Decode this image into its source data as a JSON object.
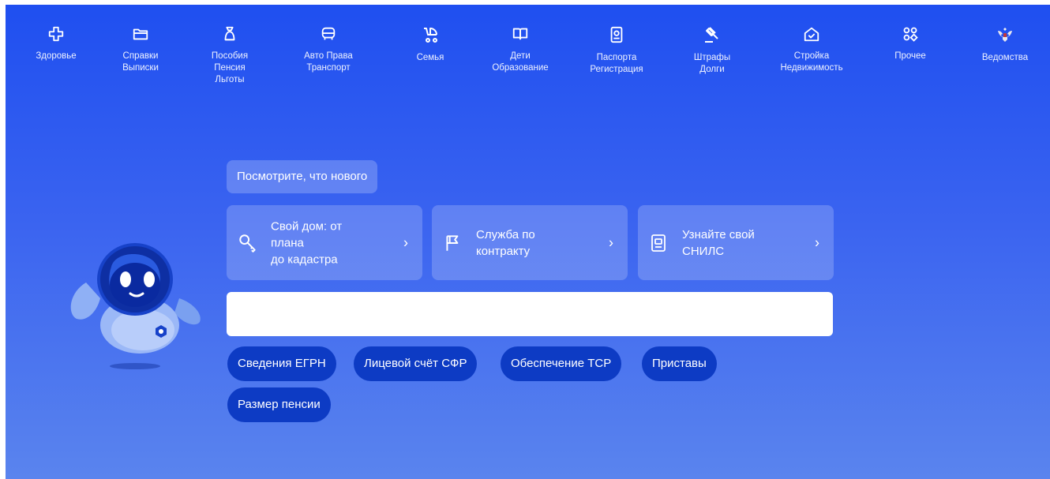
{
  "nav": {
    "items": [
      {
        "label": "Здоровье",
        "icon": "health-cross-icon"
      },
      {
        "label": "Справки\nВыписки",
        "icon": "folder-icon"
      },
      {
        "label": "Пособия\nПенсия\nЛьготы",
        "icon": "benefits-bag-icon"
      },
      {
        "label": "Авто Права\nТранспорт",
        "icon": "car-icon"
      },
      {
        "label": "Семья",
        "icon": "stroller-icon"
      },
      {
        "label": "Дети\nОбразование",
        "icon": "book-icon"
      },
      {
        "label": "Паспорта\nРегистрация",
        "icon": "passport-icon"
      },
      {
        "label": "Штрафы\nДолги",
        "icon": "gavel-icon"
      },
      {
        "label": "Стройка\nНедвижимость",
        "icon": "house-icon"
      },
      {
        "label": "Прочее",
        "icon": "grid-icon"
      },
      {
        "label": "Ведомства",
        "icon": "coat-of-arms-icon"
      }
    ]
  },
  "promo": {
    "whats_new": "Посмотрите, что нового",
    "cards": [
      {
        "text": "Свой дом: от\nплана\nдо кадастра",
        "icon": "key-icon"
      },
      {
        "text": "Служба по\nконтракту",
        "icon": "flag-icon"
      },
      {
        "text": "Узнайте свой\nСНИЛС",
        "icon": "id-card-icon"
      }
    ],
    "chevron": "›"
  },
  "search": {
    "value": "",
    "placeholder": ""
  },
  "chips": [
    "Сведения ЕГРН",
    "Лицевой счёт СФР",
    "Обеспечение ТСР",
    "Приставы",
    "Размер пенсии"
  ],
  "colors": {
    "background_top": "#1f4ff0",
    "background_bottom": "#5a84ee",
    "chip": "#0d3bc4"
  }
}
